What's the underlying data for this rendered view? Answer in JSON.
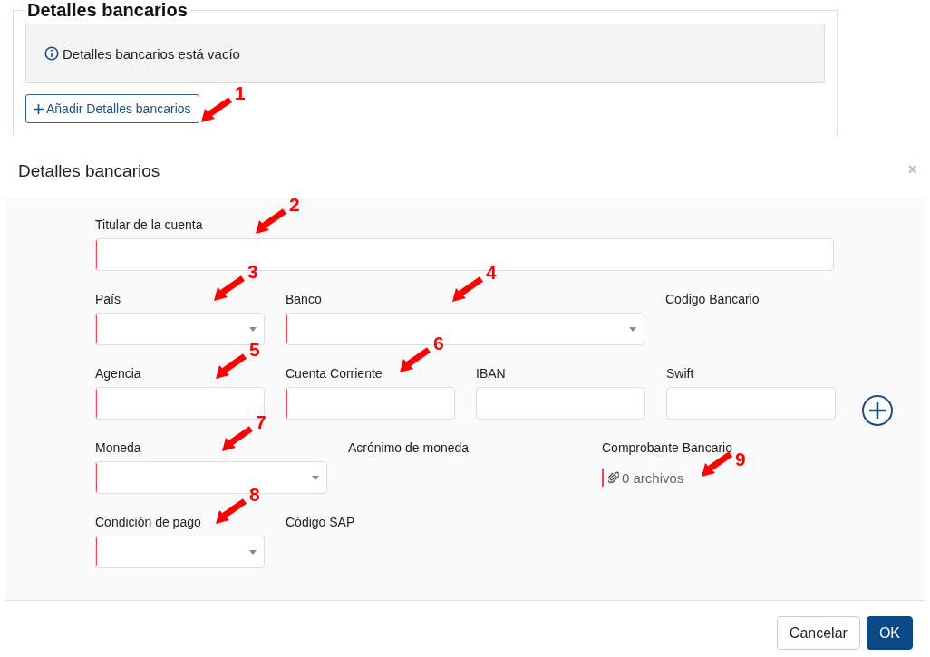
{
  "section": {
    "title": "Detalles bancarios",
    "empty_message": "Detalles bancarios está vacío",
    "add_button": "Añadir Detalles bancarios"
  },
  "dialog": {
    "title": "Detalles bancarios",
    "close": "×",
    "rows": [
      [
        {
          "label": "Titular de la cuenta",
          "kind": "text",
          "required": true
        }
      ],
      [
        {
          "label": "País",
          "kind": "select",
          "required": true
        },
        {
          "label": "Banco",
          "kind": "select",
          "required": true
        },
        {
          "label": "Codigo Bancario",
          "kind": "static"
        }
      ],
      [
        {
          "label": "Agencia",
          "kind": "text",
          "required": true
        },
        {
          "label": "Cuenta Corriente",
          "kind": "text",
          "required": true
        },
        {
          "label": "IBAN",
          "kind": "text",
          "required": false
        },
        {
          "label": "Swift",
          "kind": "text",
          "required": false
        }
      ],
      [
        {
          "label": "Moneda",
          "kind": "select",
          "required": true
        },
        {
          "label": "Acrónimo de moneda",
          "kind": "static"
        },
        {
          "label": "Comprobante Bancario",
          "kind": "files",
          "value": "0 archivos",
          "required": true
        }
      ],
      [
        {
          "label": "Condición de pago",
          "kind": "select",
          "required": true
        },
        {
          "label": "Código SAP",
          "kind": "static"
        }
      ]
    ],
    "buttons": [
      {
        "label": "Cancelar",
        "primary": false
      },
      {
        "label": "OK",
        "primary": true
      }
    ]
  },
  "annotations": [
    {
      "number": "1"
    },
    {
      "number": "2"
    },
    {
      "number": "3"
    },
    {
      "number": "4"
    },
    {
      "number": "5"
    },
    {
      "number": "6"
    },
    {
      "number": "7"
    },
    {
      "number": "8"
    },
    {
      "number": "9"
    }
  ]
}
